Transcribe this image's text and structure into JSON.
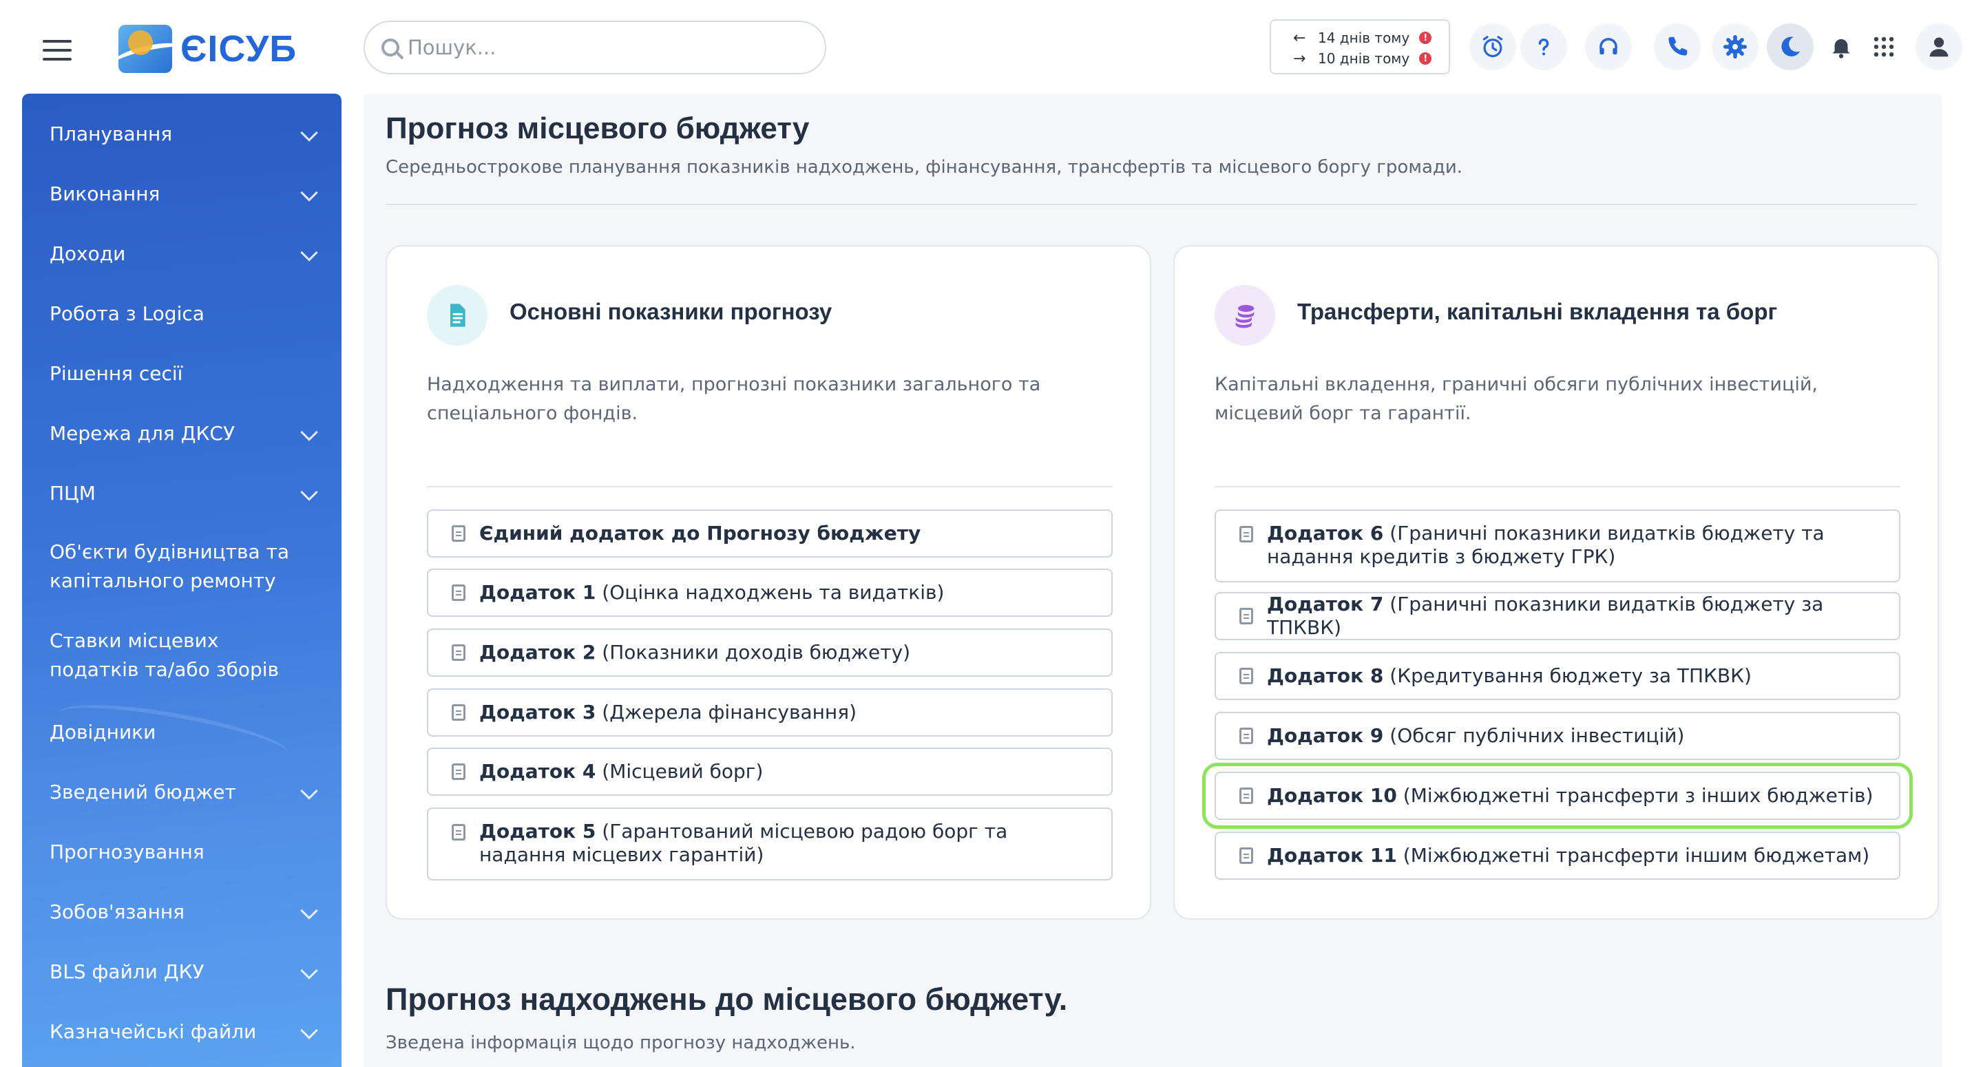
{
  "app": {
    "logo_text": "ЄІСУБ",
    "search_placeholder": "Пошук...",
    "recent": [
      {
        "label": "14 днів тому",
        "direction": "back",
        "badge": "!"
      },
      {
        "label": "10 днів тому",
        "direction": "forward",
        "badge": "!"
      }
    ],
    "toolbar_icons": [
      "alarm-clock-icon",
      "help-icon",
      "headset-icon",
      "phone-icon",
      "gear-icon",
      "moon-icon",
      "bell-icon",
      "apps-grid-icon",
      "user-icon"
    ],
    "accent_color": "#2467d8",
    "highlight_color": "#8de45a"
  },
  "sidebar": {
    "items": [
      {
        "label": "Планування",
        "expandable": true
      },
      {
        "label": "Виконання",
        "expandable": true
      },
      {
        "label": "Доходи",
        "expandable": true
      },
      {
        "label": "Робота з Logica",
        "expandable": false
      },
      {
        "label": "Рішення сесії",
        "expandable": false
      },
      {
        "label": "Мережа для ДКСУ",
        "expandable": true
      },
      {
        "label": "ПЦМ",
        "expandable": true
      },
      {
        "label": "Об'єкти будівництва та капітального ремонту",
        "expandable": false
      },
      {
        "label": "Ставки місцевих податків та/або зборів",
        "expandable": false
      },
      {
        "label": "Довідники",
        "expandable": false
      },
      {
        "label": "Зведений бюджет",
        "expandable": true
      },
      {
        "label": "Прогнозування",
        "expandable": false
      },
      {
        "label": "Зобов'язання",
        "expandable": true
      },
      {
        "label": "BLS файли ДКУ",
        "expandable": true
      },
      {
        "label": "Казначейські файли",
        "expandable": true
      }
    ]
  },
  "main": {
    "title": "Прогноз місцевого бюджету",
    "subtitle": "Середньострокове планування показників надходжень, фінансування, трансфертів та місцевого боргу громади.",
    "cards": [
      {
        "title": "Основні показники прогнозу",
        "icon": "document-icon",
        "description": "Надходження та виплати, прогнозні показники загального та спеціального фондів.",
        "buttons": [
          {
            "bold": "Єдиний додаток до Прогнозу бюджету",
            "rest": ""
          },
          {
            "bold": "Додаток 1",
            "rest": " (Оцінка надходжень та видатків)"
          },
          {
            "bold": "Додаток 2",
            "rest": " (Показники доходів бюджету)"
          },
          {
            "bold": "Додаток 3",
            "rest": " (Джерела фінансування)"
          },
          {
            "bold": "Додаток 4",
            "rest": " (Місцевий борг)"
          },
          {
            "bold": "Додаток 5",
            "rest": " (Гарантований місцевою радою борг та надання місцевих гарантій)"
          }
        ]
      },
      {
        "title": "Трансферти, капітальні вкладення та борг",
        "icon": "coins-icon",
        "description": "Капітальні вкладення, граничні обсяги публічних інвестицій, місцевий борг та гарантії.",
        "buttons": [
          {
            "bold": "Додаток 6",
            "rest": " (Граничні показники видатків бюджету та надання кредитів з бюджету ГРК)"
          },
          {
            "bold": "Додаток 7",
            "rest": " (Граничні показники видатків бюджету за ТПКВК)"
          },
          {
            "bold": "Додаток 8",
            "rest": " (Кредитування бюджету за ТПКВК)"
          },
          {
            "bold": "Додаток 9",
            "rest": " (Обсяг публічних інвестицій)"
          },
          {
            "bold": "Додаток 10",
            "rest": " (Міжбюджетні трансферти з інших бюджетів)",
            "highlighted": true
          },
          {
            "bold": "Додаток 11",
            "rest": " (Міжбюджетні трансферти іншим бюджетам)"
          }
        ]
      }
    ],
    "section2_title": "Прогноз надходжень до місцевого бюджету.",
    "section2_subtitle": "Зведена інформація щодо прогнозу надходжень."
  }
}
